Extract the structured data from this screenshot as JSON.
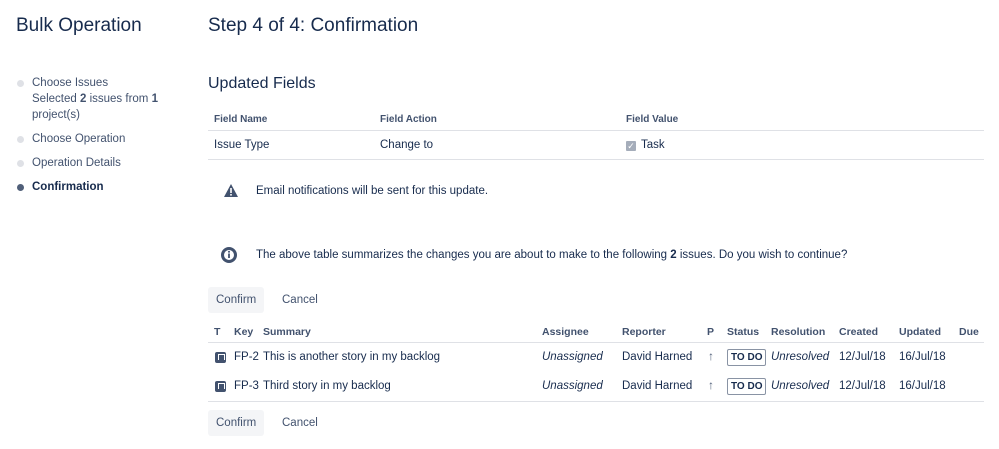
{
  "sidebar": {
    "title": "Bulk Operation",
    "steps": [
      {
        "label": "Choose Issues",
        "detail_prefix": "Selected",
        "detail_count": "2",
        "detail_middle": "issues from",
        "detail_projects": "1",
        "detail_suffix": "project(s)"
      },
      {
        "label": "Choose Operation"
      },
      {
        "label": "Operation Details"
      },
      {
        "label": "Confirmation"
      }
    ]
  },
  "main": {
    "title": "Step 4 of 4: Confirmation",
    "updated_fields": {
      "heading": "Updated Fields",
      "columns": [
        "Field Name",
        "Field Action",
        "Field Value"
      ],
      "rows": [
        {
          "name": "Issue Type",
          "action": "Change to",
          "value": "Task"
        }
      ]
    },
    "notification_text": "Email notifications will be sent for this update.",
    "summary": {
      "prefix": "The above table summarizes the changes you are about to make to the following",
      "count": "2",
      "suffix": "issues. Do you wish to continue?"
    },
    "buttons": {
      "confirm": "Confirm",
      "cancel": "Cancel"
    },
    "issues": {
      "columns": [
        "T",
        "Key",
        "Summary",
        "Assignee",
        "Reporter",
        "P",
        "Status",
        "Resolution",
        "Created",
        "Updated",
        "Due"
      ],
      "rows": [
        {
          "key": "FP-2",
          "summary": "This is another story in my backlog",
          "assignee": "Unassigned",
          "reporter": "David Harned",
          "priority_icon": "arrow-up-icon",
          "status": "TO DO",
          "resolution": "Unresolved",
          "created": "12/Jul/18",
          "updated": "16/Jul/18",
          "due": ""
        },
        {
          "key": "FP-3",
          "summary": "Third story in my backlog",
          "assignee": "Unassigned",
          "reporter": "David Harned",
          "priority_icon": "arrow-up-icon",
          "status": "TO DO",
          "resolution": "Unresolved",
          "created": "12/Jul/18",
          "updated": "16/Jul/18",
          "due": ""
        }
      ]
    }
  }
}
